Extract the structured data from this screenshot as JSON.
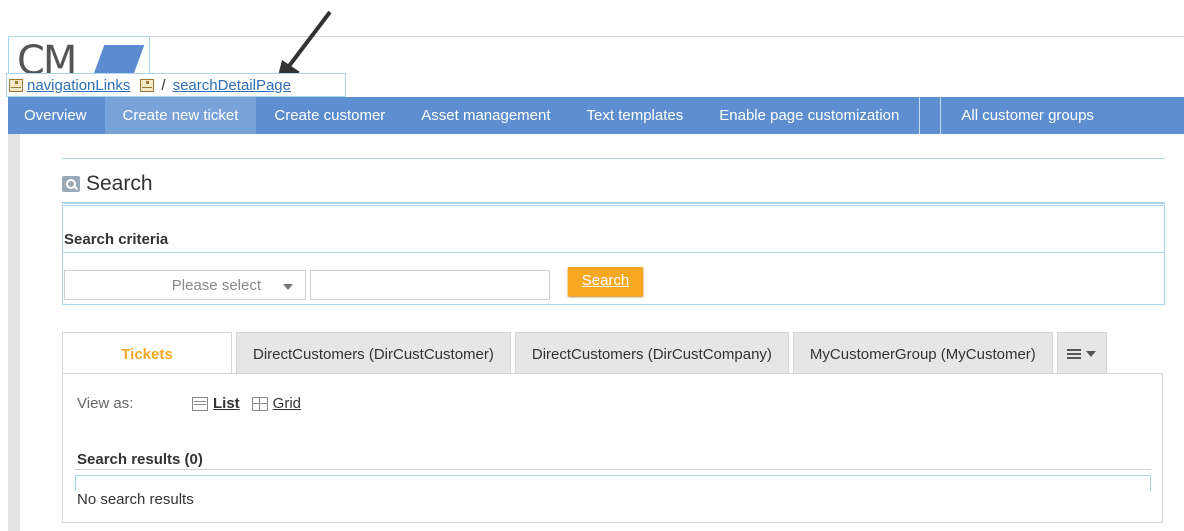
{
  "logo": {
    "text": "CM"
  },
  "breadcrumb": {
    "first": "navigationLinks",
    "separator": "/",
    "second": "searchDetailPage"
  },
  "nav": {
    "items": [
      "Overview",
      "Create new ticket",
      "Create customer",
      "Asset management",
      "Text templates",
      "Enable page customization"
    ],
    "active_index": 1,
    "customer_groups": "All customer groups"
  },
  "search": {
    "title": "Search",
    "criteria_label": "Search criteria",
    "select_placeholder": "Please select",
    "input_value": "",
    "button_label": "Search"
  },
  "results": {
    "tabs": [
      "Tickets",
      "DirectCustomers (DirCustCustomer)",
      "DirectCustomers (DirCustCompany)",
      "MyCustomerGroup (MyCustomer)"
    ],
    "view_as_label": "View as:",
    "view_list": "List",
    "view_grid": "Grid",
    "results_title": "Search results (0)",
    "no_results": "No search results"
  },
  "colors": {
    "nav_bg": "#5d8ecf",
    "accent": "#f7a823",
    "link": "#2f6fb5",
    "border": "#a9d6ef"
  }
}
